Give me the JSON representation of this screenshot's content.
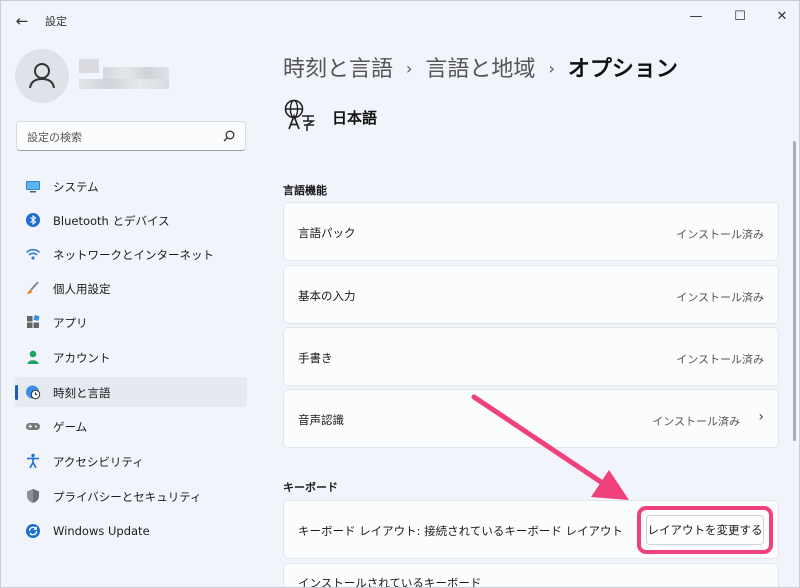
{
  "window": {
    "title": "設定",
    "back_icon": "←",
    "minimize_icon": "—",
    "maximize_icon": "☐",
    "close_icon": "✕"
  },
  "search": {
    "placeholder": "設定の検索"
  },
  "sidebar": {
    "items": [
      {
        "label": "システム",
        "icon": "monitor-icon",
        "active": false
      },
      {
        "label": "Bluetooth とデバイス",
        "icon": "bluetooth-icon",
        "active": false
      },
      {
        "label": "ネットワークとインターネット",
        "icon": "wifi-icon",
        "active": false
      },
      {
        "label": "個人用設定",
        "icon": "brush-icon",
        "active": false
      },
      {
        "label": "アプリ",
        "icon": "apps-icon",
        "active": false
      },
      {
        "label": "アカウント",
        "icon": "account-icon",
        "active": false
      },
      {
        "label": "時刻と言語",
        "icon": "globe-clock-icon",
        "active": true
      },
      {
        "label": "ゲーム",
        "icon": "gamepad-icon",
        "active": false
      },
      {
        "label": "アクセシビリティ",
        "icon": "accessibility-icon",
        "active": false
      },
      {
        "label": "プライバシーとセキュリティ",
        "icon": "shield-icon",
        "active": false
      },
      {
        "label": "Windows Update",
        "icon": "update-icon",
        "active": false
      }
    ]
  },
  "breadcrumb": {
    "part1": "時刻と言語",
    "part2": "言語と地域",
    "current": "オプション",
    "separator": "›"
  },
  "language": {
    "name": "日本語",
    "icon": "language-icon"
  },
  "sections": {
    "features_title": "言語機能",
    "keyboard_title": "キーボード"
  },
  "features": [
    {
      "label": "言語パック",
      "status": "インストール済み"
    },
    {
      "label": "基本の入力",
      "status": "インストール済み"
    },
    {
      "label": "手書き",
      "status": "インストール済み"
    },
    {
      "label": "音声認識",
      "status": "インストール済み",
      "chevron": "›"
    }
  ],
  "keyboard": {
    "layout_label": "キーボード レイアウト: 接続されているキーボード レイアウト",
    "change_button": "レイアウトを変更する",
    "installed_label": "インストールされているキーボード"
  },
  "colors": {
    "accent": "#1a5fb4",
    "highlight": "#f0417c",
    "background": "#f1f4fa",
    "card": "#fbfcfe"
  }
}
